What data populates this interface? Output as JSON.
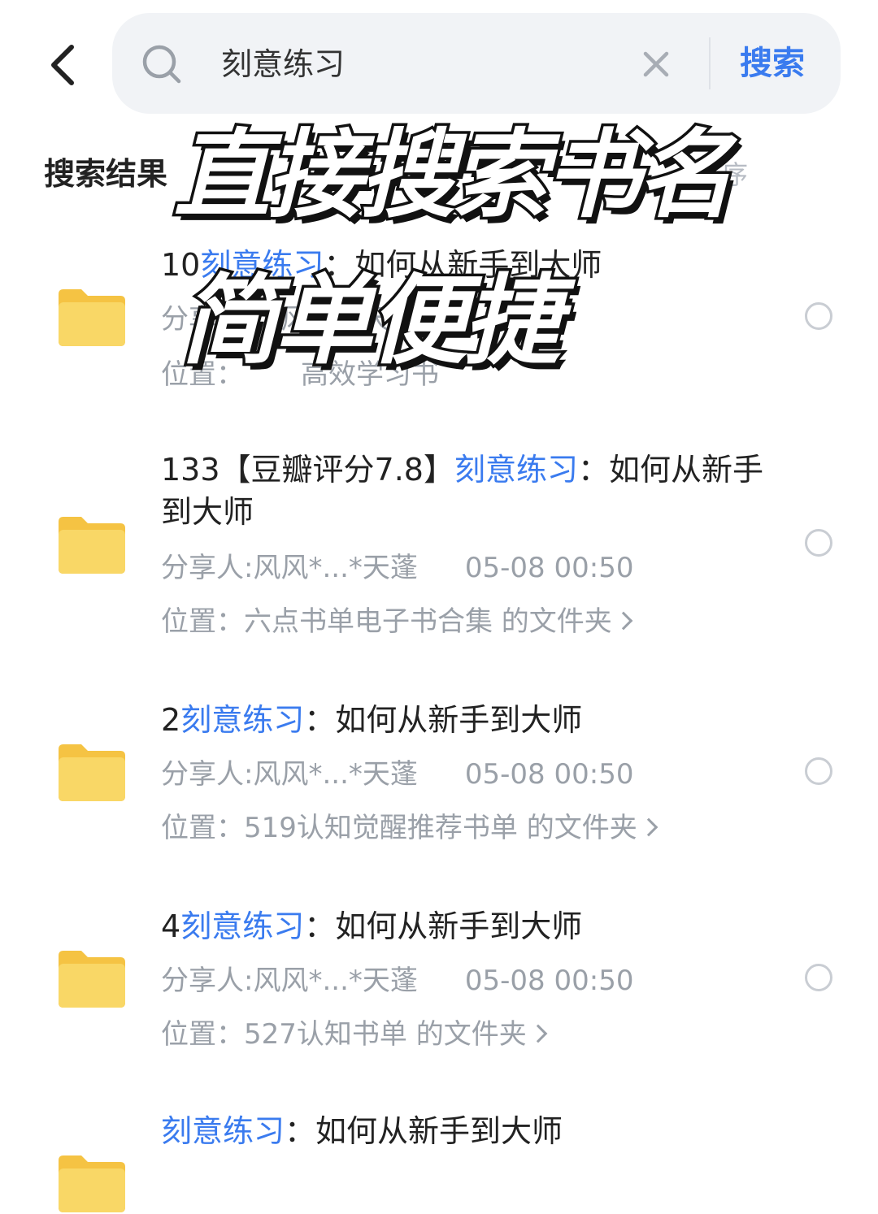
{
  "header": {
    "search_query": "刻意练习",
    "search_button": "搜索"
  },
  "results_label": "搜索结果",
  "sort_label_partial": "序",
  "results": [
    {
      "prefix": "10",
      "keyword": "刻意练习",
      "suffix": "：如何从新手到大师",
      "sharer": "分享人:风风*...*天蓬",
      "time": "",
      "location": "位置：",
      "location_tail": "高效学习书"
    },
    {
      "prefix": "133【豆瓣评分7.8】",
      "keyword": "刻意练习",
      "suffix": "：如何从新手到大师",
      "sharer": "分享人:风风*...*天蓬",
      "time": "05-08 00:50",
      "location": "位置：六点书单电子书合集 的文件夹"
    },
    {
      "prefix": "2",
      "keyword": "刻意练习",
      "suffix": "：如何从新手到大师",
      "sharer": "分享人:风风*...*天蓬",
      "time": "05-08 00:50",
      "location": "位置：519认知觉醒推荐书单 的文件夹"
    },
    {
      "prefix": "4",
      "keyword": "刻意练习",
      "suffix": "：如何从新手到大师",
      "sharer": "分享人:风风*...*天蓬",
      "time": "05-08 00:50",
      "location": "位置：527认知书单 的文件夹"
    },
    {
      "prefix": "",
      "keyword": "刻意练习",
      "suffix": "：如何从新手到大师"
    }
  ],
  "overlay": {
    "line1": "直接搜索书名",
    "line2": "简单便捷"
  },
  "colors": {
    "accent": "#3a7bef",
    "folder": "#f9d25c",
    "meta": "#9aa0a8"
  }
}
